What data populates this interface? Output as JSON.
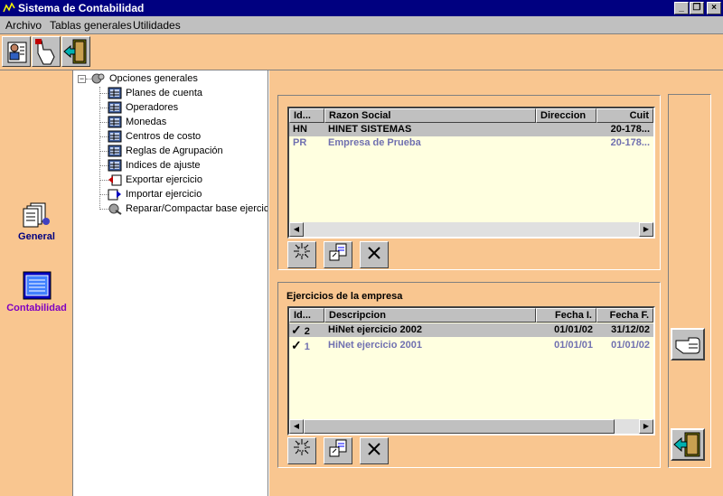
{
  "window": {
    "title": "Sistema de Contabilidad"
  },
  "menu": [
    "Archivo",
    "Tablas generales",
    "Utilidades"
  ],
  "toolbar": {
    "items": [
      "users-icon",
      "hand-pointer-icon",
      "exit-door-icon"
    ]
  },
  "sidebar": {
    "items": [
      {
        "label": "General",
        "icon": "documents-stack-icon"
      },
      {
        "label": "Contabilidad",
        "icon": "ledger-window-icon"
      }
    ]
  },
  "tree": {
    "root": "Opciones generales",
    "items": [
      "Planes de cuenta",
      "Operadores",
      "Monedas",
      "Centros de costo",
      "Reglas de Agrupación",
      "Indices de ajuste",
      "Exportar ejercicio",
      "Importar ejercicio",
      "Reparar/Compactar base ejercic"
    ]
  },
  "empresas": {
    "columns": [
      "Id...",
      "Razon Social",
      "Direccion",
      "Cuit"
    ],
    "rows": [
      {
        "id": "HN",
        "razon": "HINET SISTEMAS",
        "direccion": "",
        "cuit": "20-178..."
      },
      {
        "id": "PR",
        "razon": "Empresa de Prueba",
        "direccion": "",
        "cuit": "20-178..."
      }
    ],
    "selected_row": 0
  },
  "ejercicios": {
    "title": "Ejercicios de la empresa",
    "columns": [
      "Id...",
      "Descripcion",
      "Fecha I.",
      "Fecha F."
    ],
    "rows": [
      {
        "check": "✓",
        "id": "2",
        "descripcion": "HiNet ejercicio 2002",
        "fecha_i": "01/01/02",
        "fecha_f": "31/12/02"
      },
      {
        "check": "✓",
        "id": "1",
        "descripcion": "HiNet ejercicio 2001",
        "fecha_i": "01/01/01",
        "fecha_f": "01/01/02"
      }
    ],
    "selected_row": 0
  },
  "colors": {
    "panel": "#f9c690",
    "grid": "#ffffe0",
    "titlebar": "#000080",
    "sidebar_label_accent": "#8000c0"
  }
}
